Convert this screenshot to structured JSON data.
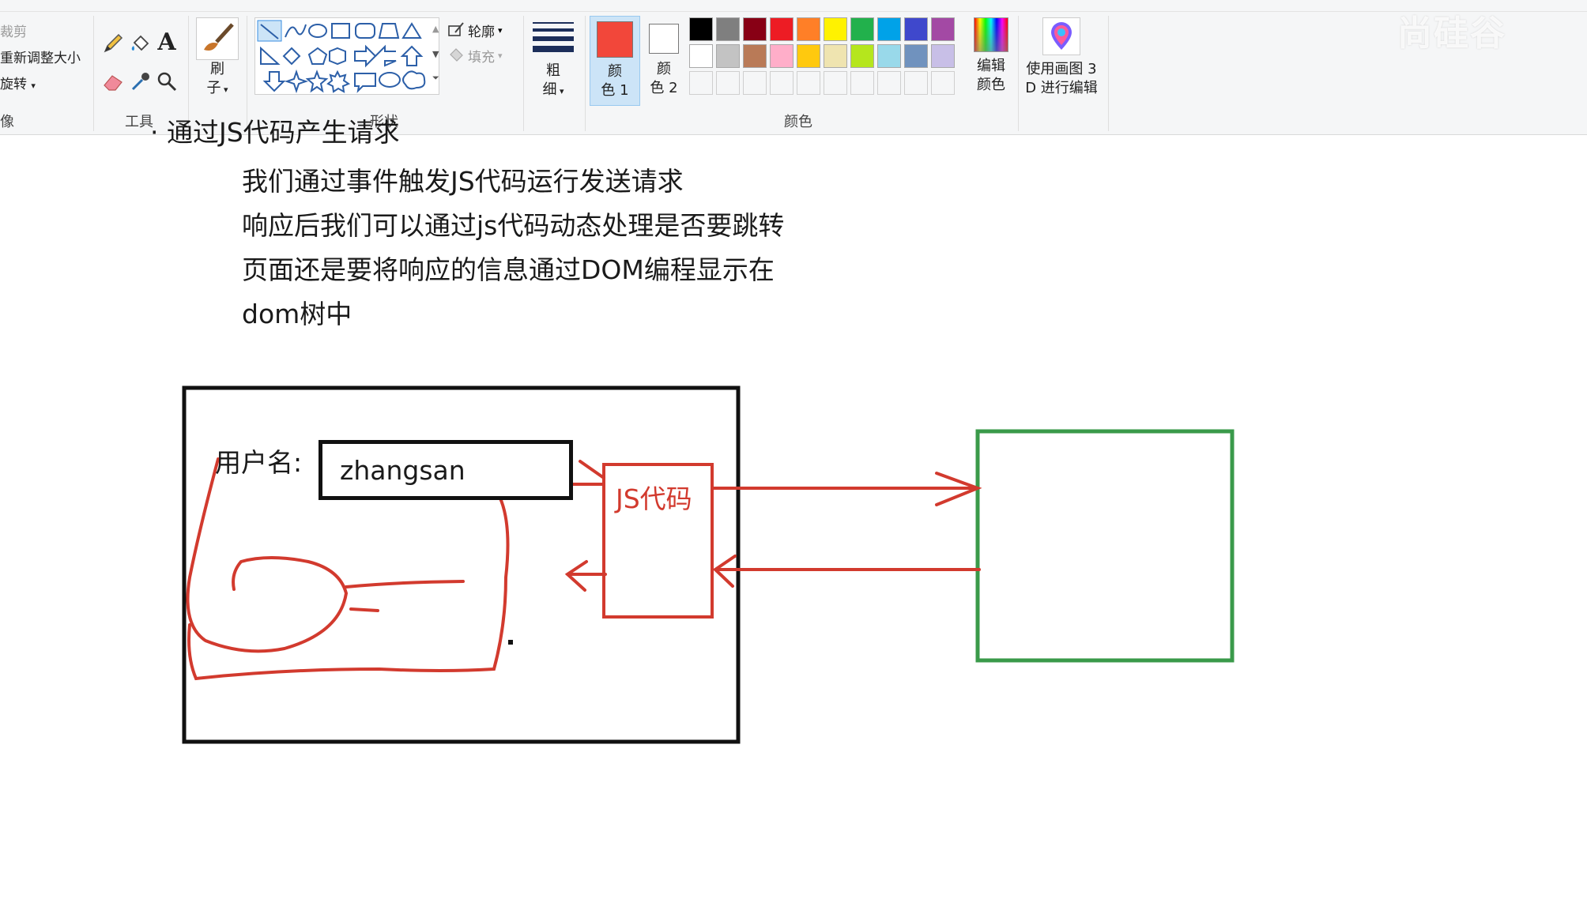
{
  "ribbon": {
    "image_group": {
      "crop_label": "裁剪",
      "resize_label": "重新调整大小",
      "rotate_label": "旋转",
      "group_label": "像"
    },
    "tools_group": {
      "group_label": "工具"
    },
    "brush": {
      "label_line1": "刷",
      "label_line2": "子"
    },
    "shapes_group": {
      "outline_label": "轮廓",
      "fill_label": "填充",
      "group_label": "形状"
    },
    "size": {
      "label_line1": "粗",
      "label_line2": "细"
    },
    "color1": {
      "label_line1": "颜",
      "label_line2": "色 1",
      "value": "#f2473a"
    },
    "color2": {
      "label_line1": "颜",
      "label_line2": "色 2",
      "value": "#ffffff"
    },
    "colors_group": {
      "group_label": "颜色",
      "palette_row1": [
        "#000000",
        "#7f7f7f",
        "#880015",
        "#ed1c24",
        "#ff7f27",
        "#fff200",
        "#22b14c",
        "#00a2e8",
        "#3f48cc",
        "#a349a4"
      ],
      "palette_row2": [
        "#ffffff",
        "#c3c3c3",
        "#b97a57",
        "#ffaec9",
        "#ffc90e",
        "#efe4b0",
        "#b5e61d",
        "#99d9ea",
        "#7092be",
        "#c8bfe7"
      ]
    },
    "edit_colors": {
      "label_line1": "编辑",
      "label_line2": "颜色"
    },
    "paint3d": {
      "label_line1": "使用画图 3",
      "label_line2": "D 进行编辑"
    },
    "watermark": "尚硅谷"
  },
  "canvas": {
    "cut_line": "· 通过JS代码产生请求",
    "notes": [
      "我们通过事件触发JS代码运行发送请求",
      "响应后我们可以通过js代码动态处理是否要跳转",
      "页面还是要将响应的信息通过DOM编程显示在",
      "dom树中"
    ],
    "username_label": "用户名:",
    "username_value": "zhangsan",
    "js_box_label": "JS代码",
    "colors": {
      "red": "#d23a2e",
      "green": "#3a9a4a",
      "black": "#111111"
    }
  }
}
